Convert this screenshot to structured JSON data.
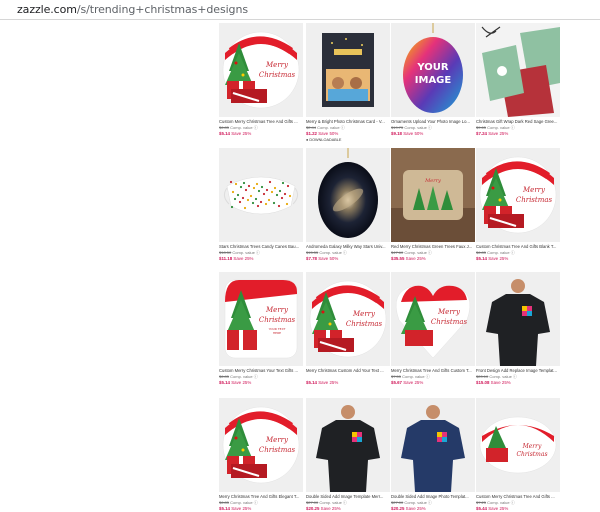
{
  "browser": {
    "url_domain": "zazzle.com",
    "url_path": "/s/trending+christmas+designs"
  },
  "colors": {
    "sale_pink": "#d0185a",
    "christmas_red": "#e21d2a",
    "tree_green": "#2f8d3a"
  },
  "products": [
    {
      "title": "Custom Merry Christmas Tree And Gifts ...",
      "orig": "$6.85",
      "comp": "Comp. value ⓘ",
      "sale": "$5.14",
      "save": "Save 25%",
      "icon": "christmas-tree-sticker-round"
    },
    {
      "title": "Merry & Bright Photo Christmas Card - V...",
      "orig": "$2.44",
      "comp": "Comp. value ⓘ",
      "sale": "$1.22",
      "save": "Save 50%",
      "badge": "DOWNLOADABLE",
      "icon": "photo-card"
    },
    {
      "title": "Ornaments Upload Your Photo Image Lo...",
      "orig": "$19.75",
      "comp": "Comp. value ⓘ",
      "sale": "$9.18",
      "save": "Save 50%",
      "overlay": "YOUR IMAGE",
      "icon": "oval-ornament"
    },
    {
      "title": "Christmas Gift Wrap Dark Red Sage Gree...",
      "orig": "$9.65",
      "comp": "Comp. value ⓘ",
      "sale": "$7.24",
      "save": "Save 25%",
      "icon": "gift-wrap"
    },
    {
      "title": "Stars Christmas Trees Candy Canes Bau...",
      "orig": "$18.50",
      "comp": "Comp. value ⓘ",
      "sale": "$11.18",
      "save": "Save 25%",
      "icon": "face-mask"
    },
    {
      "title": "Andromeda Galaxy Milky Way Stars Univ...",
      "orig": "$15.55",
      "comp": "Comp. value ⓘ",
      "sale": "$7.78",
      "save": "Save 50%",
      "icon": "galaxy-ornament"
    },
    {
      "title": "Red Merry Christmas Green Trees Faux J...",
      "orig": "$47.60",
      "comp": "Comp. value ⓘ",
      "sale": "$35.55",
      "save": "Save 25%",
      "icon": "pillow"
    },
    {
      "title": "Custom Christmas Tree And Gifts Blank T...",
      "orig": "$6.85",
      "comp": "Comp. value ⓘ",
      "sale": "$5.14",
      "save": "Save 25%",
      "icon": "christmas-tree-sticker-round"
    },
    {
      "title": "Custom Merry Christmas Your Text Gifts ...",
      "orig": "$6.85",
      "comp": "Comp. value ⓘ",
      "sale": "$5.14",
      "save": "Save 25%",
      "icon": "christmas-sticker-square"
    },
    {
      "title": "Merry Christmas Custom Add Your Text ...",
      "orig": "",
      "comp": "",
      "sale": "$5.14",
      "save": "Save 25%",
      "icon": "christmas-sticker-round"
    },
    {
      "title": "Merry Christmas Tree And Gifts Custom T...",
      "orig": "$7.55",
      "comp": "Comp. value ⓘ",
      "sale": "$5.67",
      "save": "Save 25%",
      "icon": "christmas-sticker-heart"
    },
    {
      "title": "Front Design Add Replace Image Templat...",
      "orig": "$20.10",
      "comp": "Comp. value ⓘ",
      "sale": "$15.08",
      "save": "Save 25%",
      "icon": "black-tshirt"
    },
    {
      "title": "Merry Christmas Tree And Gifts Elegant T...",
      "orig": "$6.85",
      "comp": "Comp. value ⓘ",
      "sale": "$5.14",
      "save": "Save 25%",
      "icon": "christmas-sticker-round"
    },
    {
      "title": "Double Sided Add Image Template Merr...",
      "orig": "$27.00",
      "comp": "Comp. value ⓘ",
      "sale": "$20.25",
      "save": "Save 25%",
      "icon": "black-tshirt"
    },
    {
      "title": "Double Sided Add Image Photo Templat...",
      "orig": "$27.00",
      "comp": "Comp. value ⓘ",
      "sale": "$20.25",
      "save": "Save 25%",
      "icon": "navy-tshirt"
    },
    {
      "title": "Custom Merry Christmas Tree And Gifts ...",
      "orig": "$7.25",
      "comp": "Comp. value ⓘ",
      "sale": "$5.44",
      "save": "Save 25%",
      "icon": "christmas-sticker-oval"
    }
  ],
  "thumb_texts": {
    "merry": "Merry",
    "christmas": "Christmas",
    "your_text": "YOUR TEXT",
    "here": "HERE"
  }
}
